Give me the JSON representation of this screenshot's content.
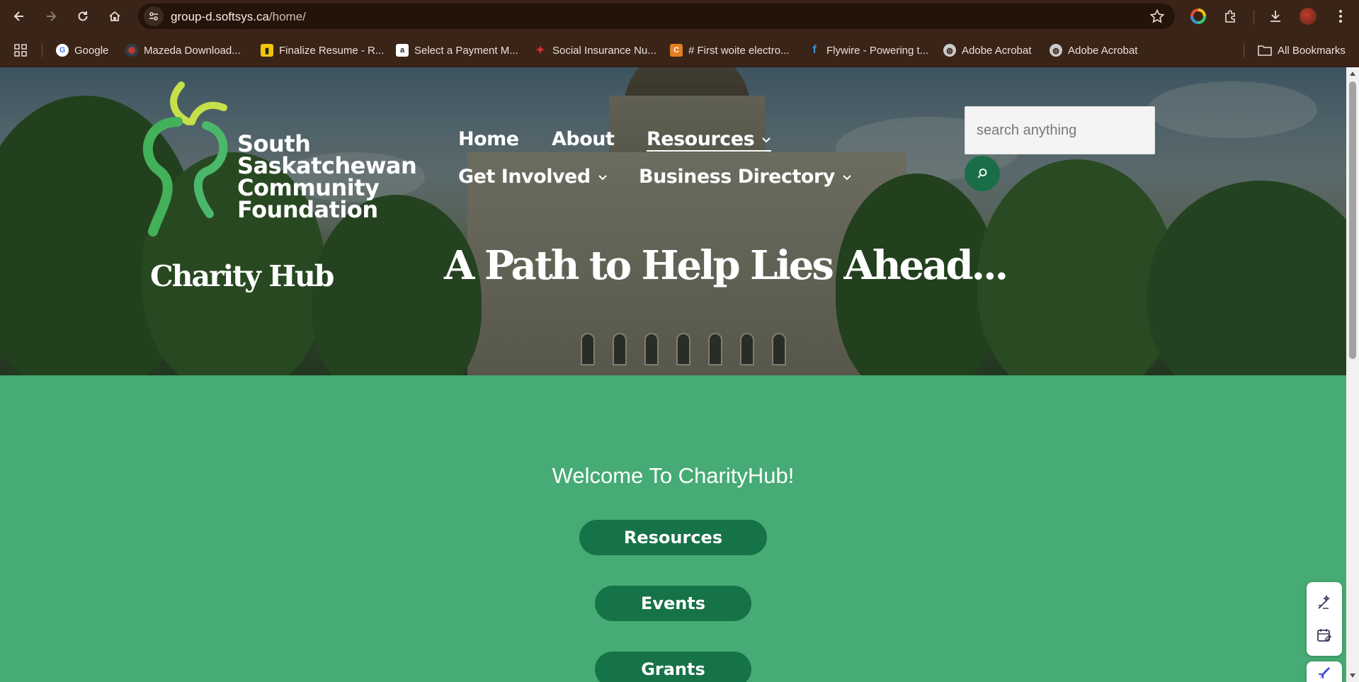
{
  "browser": {
    "url_host": "group-d.softsys.ca",
    "url_path": "/home/",
    "bookmarks": [
      {
        "label": "Google",
        "icon": "google-icon",
        "color": "#ffffff"
      },
      {
        "label": "Mazeda Download...",
        "icon": "mazeda-icon",
        "color": "#c0392b"
      },
      {
        "label": "Finalize Resume - R...",
        "icon": "resume-icon",
        "color": "#f1c40f"
      },
      {
        "label": "Select a Payment M...",
        "icon": "amazon-icon",
        "color": "#ffffff"
      },
      {
        "label": "Social Insurance Nu...",
        "icon": "maple-leaf-icon",
        "color": "#d63031"
      },
      {
        "label": "# First woite electro...",
        "icon": "c-icon",
        "color": "#e67e22"
      },
      {
        "label": "Flywire - Powering t...",
        "icon": "flywire-icon",
        "color": "#3498db"
      },
      {
        "label": "Adobe Acrobat",
        "icon": "globe-icon",
        "color": "#cccccc"
      },
      {
        "label": "Adobe Acrobat",
        "icon": "globe-icon",
        "color": "#cccccc"
      }
    ],
    "all_bookmarks": "All Bookmarks"
  },
  "hero": {
    "org_name_lines": [
      "South",
      "Saskatchewan",
      "Community",
      "Foundation"
    ],
    "site_title": "Charity Hub",
    "tagline": "A Path to Help Lies Ahead...",
    "menu": {
      "home": "Home",
      "about": "About",
      "resources": "Resources",
      "get_involved": "Get Involved",
      "business_directory": "Business Directory"
    },
    "search_placeholder": "search anything"
  },
  "main": {
    "welcome": "Welcome To CharityHub!",
    "buttons": {
      "resources": "Resources",
      "events": "Events",
      "grants": "Grants"
    }
  },
  "colors": {
    "accent_green": "#46ab74",
    "button_green": "#167347",
    "browser_chrome": "#3a2417"
  }
}
